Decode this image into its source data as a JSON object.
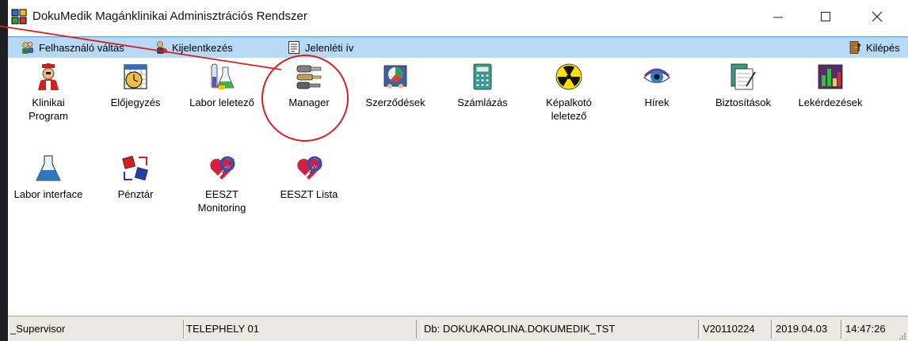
{
  "window": {
    "title": "DokuMedik Magánklinikai Adminisztrációs Rendszer"
  },
  "menubar": {
    "switch_user": "Felhasználó váltás",
    "logout": "Kijelentkezés",
    "attendance": "Jelenléti ív",
    "exit": "Kilépés"
  },
  "apps": {
    "clinical": "Klinikai\nProgram",
    "booking": "Előjegyzés",
    "lab_report": "Labor leletező",
    "manager": "Manager",
    "contracts": "Szerződések",
    "billing": "Számlázás",
    "imaging": "Képalkotó\nleletező",
    "news": "Hírek",
    "insurance": "Biztosítások",
    "queries": "Lekérdezések",
    "lab_interface": "Labor interface",
    "cashier": "Pénztár",
    "eeszt_monitoring": "EESZT\nMonitoring",
    "eeszt_list": "EESZT Lista"
  },
  "statusbar": {
    "user": "_Supervisor",
    "site": "TELEPHELY 01",
    "db": "Db: DOKUKAROLINA.DOKUMEDIK_TST",
    "version": "V20110224",
    "date": "2019.04.03",
    "time": "14:47:26"
  },
  "colors": {
    "menubar_bg": "#b6d9f6",
    "annotation": "#d62020"
  },
  "icons": {
    "app": "app-window-icon",
    "switch_user": "users-icon",
    "logout": "logout-icon",
    "attendance": "clipboard-icon",
    "exit": "exit-door-icon"
  }
}
